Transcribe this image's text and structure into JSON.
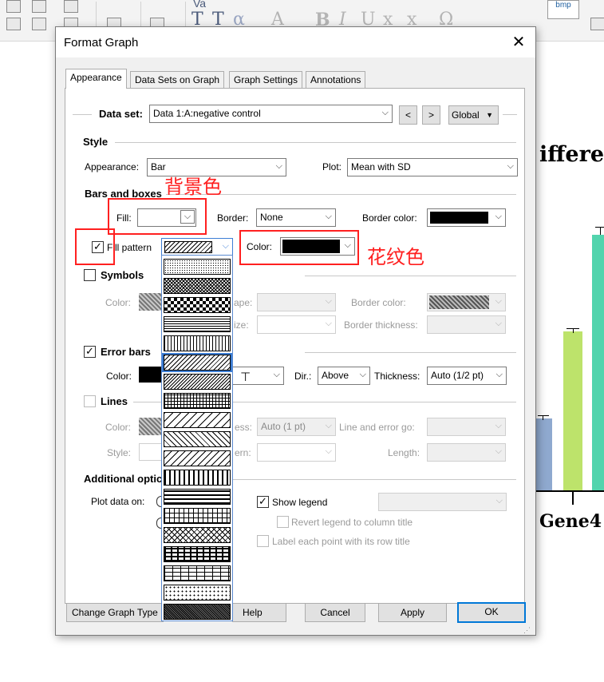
{
  "dialog": {
    "title": "Format Graph",
    "close_glyph": "✕",
    "tabs": [
      "Appearance",
      "Data Sets on Graph",
      "Graph Settings",
      "Annotations"
    ],
    "active_tab": "Appearance"
  },
  "dataset": {
    "label": "Data set:",
    "value": "Data 1:A:negative control",
    "prev": "<",
    "next": ">",
    "scope": "Global"
  },
  "style": {
    "heading": "Style",
    "appearance_label": "Appearance:",
    "appearance_value": "Bar",
    "plot_label": "Plot:",
    "plot_value": "Mean with SD"
  },
  "bars": {
    "heading": "Bars and boxes",
    "fill_label": "Fill:",
    "border_label": "Border:",
    "border_value": "None",
    "border_color_label": "Border color:",
    "fill_pattern_label": "Fill pattern",
    "fill_pattern_checked": true,
    "color_label": "Color:"
  },
  "symbols": {
    "heading": "Symbols",
    "checked": false,
    "color_label": "Color:",
    "shape_label": "ape:",
    "size_label": "ize:",
    "border_color_label": "Border color:",
    "border_thickness_label": "Border thickness:"
  },
  "error_bars": {
    "heading": "Error bars",
    "checked": true,
    "color_label": "Color:",
    "style_glyph": "⊤",
    "dir_label": "Dir.:",
    "dir_value": "Above",
    "thickness_label": "Thickness:",
    "thickness_value": "Auto (1/2 pt)"
  },
  "lines": {
    "heading": "Lines",
    "checked": false,
    "color_label": "Color:",
    "thickness_label": "ess:",
    "thickness_value": "Auto (1 pt)",
    "line_error_label": "Line and error go:",
    "style_label": "Style:",
    "pattern_label": "ern:",
    "length_label": "Length:"
  },
  "additional": {
    "heading": "Additional optic",
    "plot_on_label": "Plot data on:",
    "show_legend_label": "Show legend",
    "show_legend_checked": true,
    "revert_legend_label": "Revert legend to column title",
    "label_row_label": "Label each point with its row title"
  },
  "buttons": {
    "change_type": "Change Graph Type",
    "help": "Help",
    "cancel": "Cancel",
    "apply": "Apply",
    "ok": "OK"
  },
  "annotations": {
    "background_color_note": "背景色",
    "pattern_color_note": "花纹色"
  },
  "background_app": {
    "graph_title_fragment": "ifferer",
    "axis_label_fragment": "Gene4",
    "bar_colors": [
      "#8fa9cf",
      "#bde36b",
      "#52d4ad"
    ],
    "toolbar_text_va": "Va",
    "toolbar_text_bmp": "bmp"
  },
  "colors": {
    "accent": "#0078d7",
    "annotation": "#ff2020"
  }
}
